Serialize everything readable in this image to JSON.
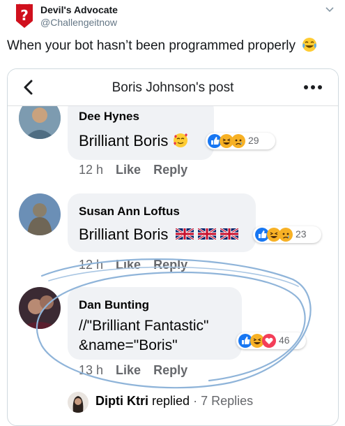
{
  "tweet": {
    "author_name": "Devil's Advocate",
    "author_handle": "@Challengeitnow",
    "text": "When your bot hasn’t been programmed properly",
    "text_emoji": "face-with-tears-of-joy-icon"
  },
  "facebook": {
    "title": "Boris Johnson's post",
    "comments": [
      {
        "name": "Dee Hynes",
        "text": "Brilliant Boris",
        "reaction_icons": [
          "like-icon",
          "haha-icon",
          "sad-icon"
        ],
        "reaction_count": "29",
        "time": "12 h",
        "like_label": "Like",
        "reply_label": "Reply"
      },
      {
        "name": "Susan Ann Loftus",
        "text": "Brilliant Boris",
        "reaction_icons": [
          "like-icon",
          "haha-icon",
          "sad-icon"
        ],
        "reaction_count": "23",
        "time": "12 h",
        "like_label": "Like",
        "reply_label": "Reply"
      },
      {
        "name": "Dan Bunting",
        "text_line1": "//\"Brilliant Fantastic\"",
        "text_line2": "&name=\"Boris\"",
        "reaction_icons": [
          "like-icon",
          "haha-icon",
          "love-icon"
        ],
        "reaction_count": "46",
        "time": "13 h",
        "like_label": "Like",
        "reply_label": "Reply"
      }
    ],
    "reply_thread": {
      "name": "Dipti Ktri",
      "action": "replied",
      "separator": "·",
      "count_label": "7 Replies"
    }
  },
  "colors": {
    "fb_blue": "#1877f2",
    "love_red": "#f33e58",
    "haha_yellow": "#f7b125",
    "annotation_blue": "#8fb4d9",
    "bubble": "#f0f2f5",
    "meta": "#65676b"
  }
}
